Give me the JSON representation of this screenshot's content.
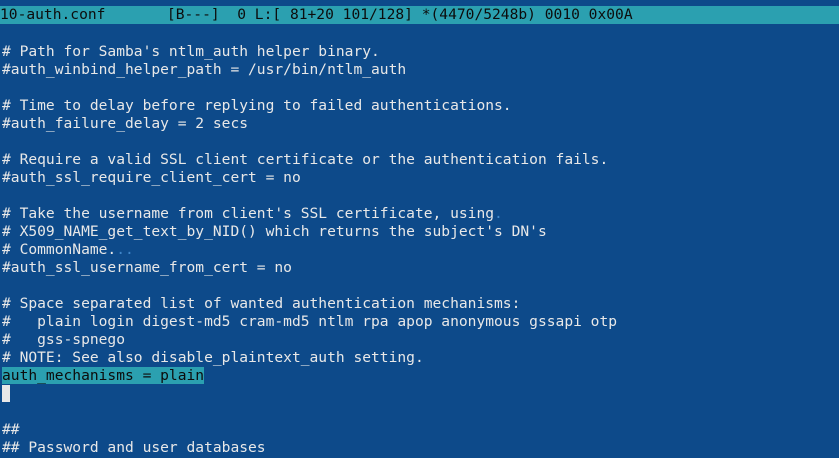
{
  "status": {
    "text": "10-auth.conf       [B---]  0 L:[ 81+20 101/128] *(4470/5248b) 0010 0x00A"
  },
  "editor": {
    "lines": [
      "",
      "# Path for Samba's ntlm_auth helper binary.",
      "#auth_winbind_helper_path = /usr/bin/ntlm_auth",
      "",
      "# Time to delay before replying to failed authentications.",
      "#auth_failure_delay = 2 secs",
      "",
      "# Require a valid SSL client certificate or the authentication fails.",
      "#auth_ssl_require_client_cert = no",
      "",
      "# Take the username from client's SSL certificate, using",
      "# X509_NAME_get_text_by_NID() which returns the subject's DN's",
      "# CommonName.",
      "#auth_ssl_username_from_cert = no",
      "",
      "# Space separated list of wanted authentication mechanisms:",
      "#   plain login digest-md5 cram-md5 ntlm rpa apop anonymous gssapi otp",
      "#   gss-spnego",
      "# NOTE: See also disable_plaintext_auth setting.",
      "auth_mechanisms = plain",
      "",
      "",
      "##",
      "## Password and user databases",
      "##"
    ],
    "trailing_markers": {
      "line_10": ".",
      "line_12": ".."
    }
  },
  "colors": {
    "background": "#0d4a8a",
    "text": "#e8e8e8",
    "status_bar": "#2ba0b0",
    "selection": "#2ba0b0"
  }
}
